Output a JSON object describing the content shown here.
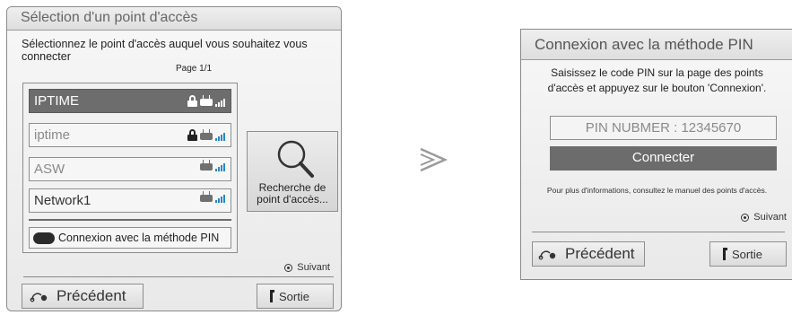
{
  "left_dialog": {
    "title": "Sélection d'un point d'accès",
    "instruction": "Sélectionnez le point d'accès auquel vous souhaitez vous connecter",
    "page_indicator": "Page 1/1",
    "access_points": [
      {
        "name": "IPTIME",
        "locked": true,
        "selected": true
      },
      {
        "name": "iptime",
        "locked": true,
        "selected": false
      },
      {
        "name": "ASW",
        "locked": false,
        "selected": false
      },
      {
        "name": "Network1",
        "locked": false,
        "selected": false
      }
    ],
    "pin_method_label": "Connexion avec la méthode PIN",
    "search_label_line1": "Recherche de",
    "search_label_line2": "point d'accès...",
    "next_label": "Suivant",
    "back_label": "Précédent",
    "exit_label": "Sortie"
  },
  "right_dialog": {
    "title": "Connexion avec la méthode PIN",
    "instruction_line1": "Saisissez le code PIN sur la page des points",
    "instruction_line2": "d'accès et appuyez sur le bouton 'Connexion'.",
    "pin_field": "PIN NUBMER : 12345670",
    "connect_label": "Connecter",
    "info": "Pour plus d'informations, consultez le manuel des points d'accès.",
    "next_label": "Suivant",
    "back_label": "Précédent",
    "exit_label": "Sortie"
  },
  "icons": {
    "lock": "lock-icon",
    "router": "router-icon",
    "signal": "wifi-signal-icon",
    "search": "magnifier-icon",
    "back": "back-arrow-icon",
    "exit": "exit-icon",
    "next_step": "chevron-right-icon",
    "radio": "radio-dot-icon"
  },
  "colors": {
    "selected_row": "#6d6d6d",
    "connect_button": "#6c6c6c",
    "signal_bars": "#2b86c8",
    "pin_pill": "#2b2b2b"
  }
}
